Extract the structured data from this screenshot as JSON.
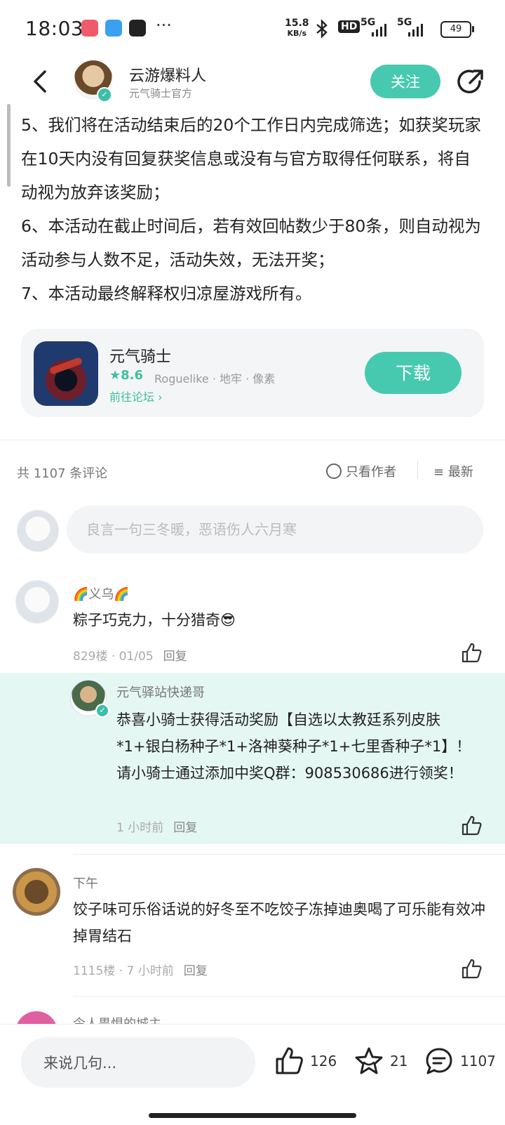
{
  "status_bar": {
    "time": "18:03",
    "speed": "15.8",
    "speed_unit": "KB/s",
    "hd": "HD",
    "net1": "5G",
    "net2": "5G",
    "battery": "49"
  },
  "header": {
    "author_name": "云游爆料人",
    "author_sub": "元气骑士官方",
    "follow_label": "关注"
  },
  "article": {
    "p5": "5、我们将在活动结束后的20个工作日内完成筛选；如获奖玩家在10天内没有回复获奖信息或没有与官方取得任何联系，将自动视为放弃该奖励；",
    "p6": "6、本活动在截止时间后，若有效回帖数少于80条，则自动视为活动参与人数不足，活动失效，无法开奖；",
    "p7": "7、本活动最终解释权归凉屋游戏所有。"
  },
  "game_card": {
    "title": "元气骑士",
    "score": "★8.6",
    "tags": "Roguelike · 地牢 · 像素",
    "link": "前往论坛 ›",
    "download_label": "下载"
  },
  "comments_header": {
    "count_text": "共 1107 条评论",
    "only_author": "只看作者",
    "sort_latest": "最新"
  },
  "comment_input": {
    "placeholder": "良言一句三冬暖，恶语伤人六月寒"
  },
  "comments": [
    {
      "name": "🌈义乌🌈",
      "text": "粽子巧克力，十分猎奇😎",
      "meta": "829楼 · 01/05",
      "reply": "回复"
    },
    {
      "name": "下午",
      "text": "饺子味可乐俗话说的好冬至不吃饺子冻掉迪奥喝了可乐能有效冲掉胃结石",
      "meta": "1115楼 · 7 小时前",
      "reply": "回复"
    },
    {
      "name": "令人畏惧的城主"
    }
  ],
  "official_reply": {
    "name": "元气驿站快递哥",
    "text": "恭喜小骑士获得活动奖励【自选以太教廷系列皮肤*1+银白杨种子*1+洛神葵种子*1+七里香种子*1】！请小骑士通过添加中奖Q群：908530686进行领奖！",
    "meta": "1 小时前",
    "reply": "回复"
  },
  "bottom_bar": {
    "input_label": "来说几句...",
    "likes": "126",
    "favorites": "21",
    "comments": "1107"
  },
  "colors": {
    "accent": "#47c9b0",
    "reply_bg": "#e5f7f3"
  }
}
